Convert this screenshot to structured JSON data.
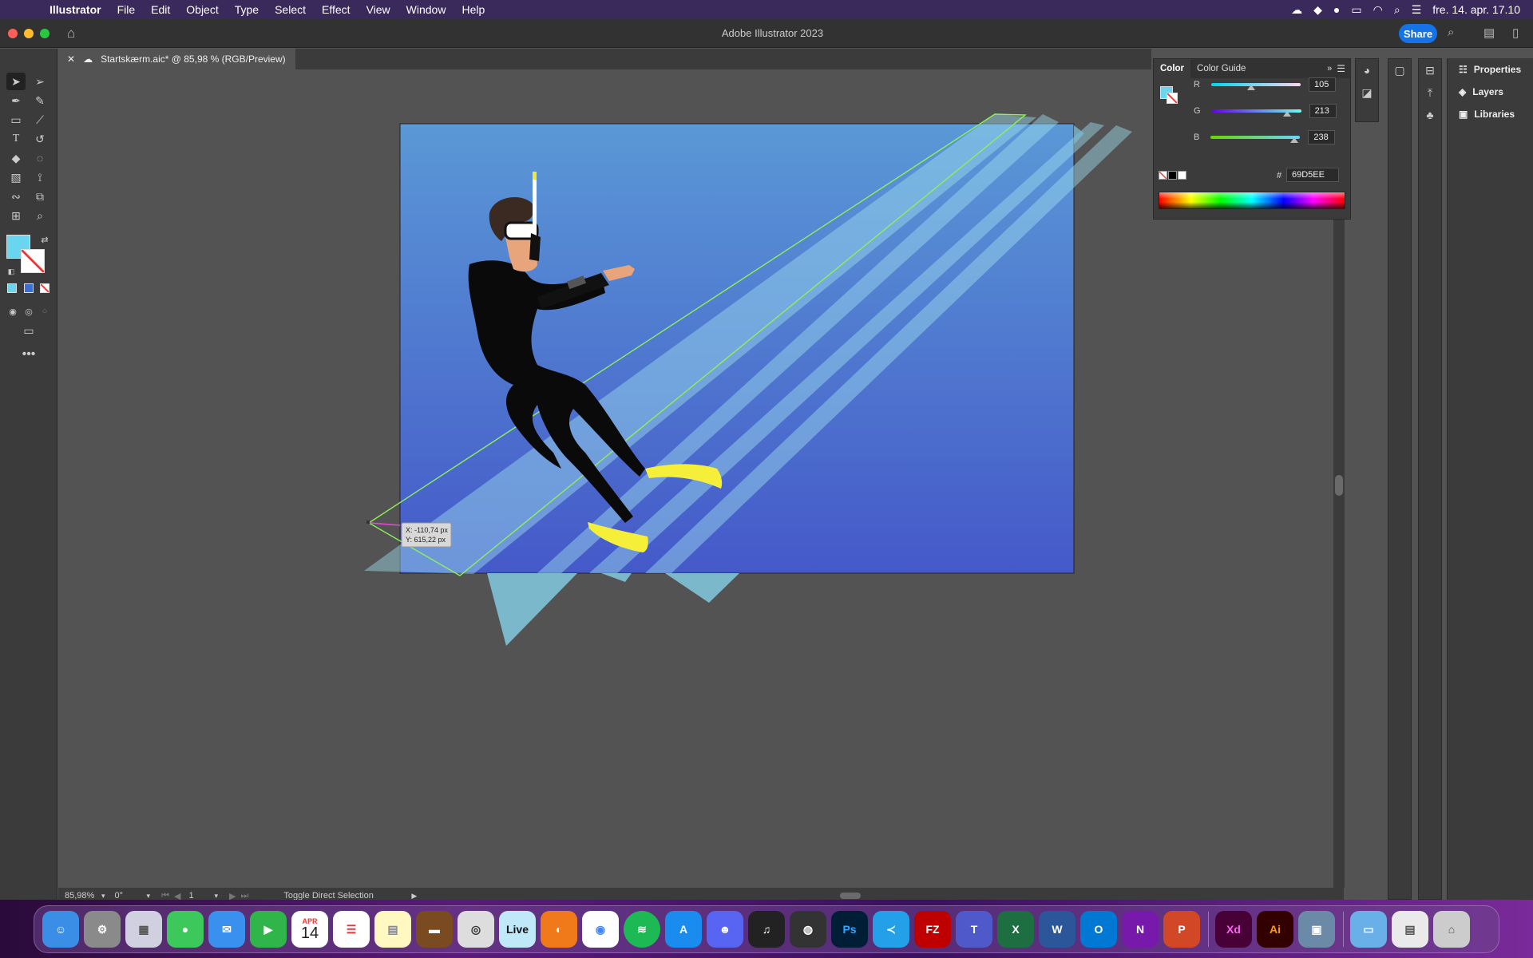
{
  "menubar": {
    "app_name": "Illustrator",
    "items": [
      "File",
      "Edit",
      "Object",
      "Type",
      "Select",
      "Effect",
      "View",
      "Window",
      "Help"
    ],
    "datetime": "fre. 14. apr. 17.10"
  },
  "window": {
    "title": "Adobe Illustrator 2023",
    "share_label": "Share"
  },
  "document": {
    "tab_label": "Startskærm.aic* @ 85,98 % (RGB/Preview)"
  },
  "cursor_readout": {
    "x": "X: -110,74 px",
    "y": "Y: 615,22 px"
  },
  "color_panel": {
    "tabs": [
      "Color",
      "Color Guide"
    ],
    "r_label": "R",
    "r_value": "105",
    "g_label": "G",
    "g_value": "213",
    "b_label": "B",
    "b_value": "238",
    "hash": "#",
    "hex_value": "69D5EE",
    "fill_color": "#69d5ee"
  },
  "right_panel": {
    "items": [
      "Properties",
      "Layers",
      "Libraries"
    ]
  },
  "statusbar": {
    "zoom": "85,98%",
    "rotation": "0°",
    "artboard": "1",
    "message": "Toggle Direct Selection"
  },
  "dock": {
    "calendar_month": "APR",
    "calendar_day": "14",
    "live_label": "Live",
    "ps_label": "Ps",
    "fz_label": "FZ",
    "xd_label": "Xd",
    "ai_label": "Ai"
  }
}
